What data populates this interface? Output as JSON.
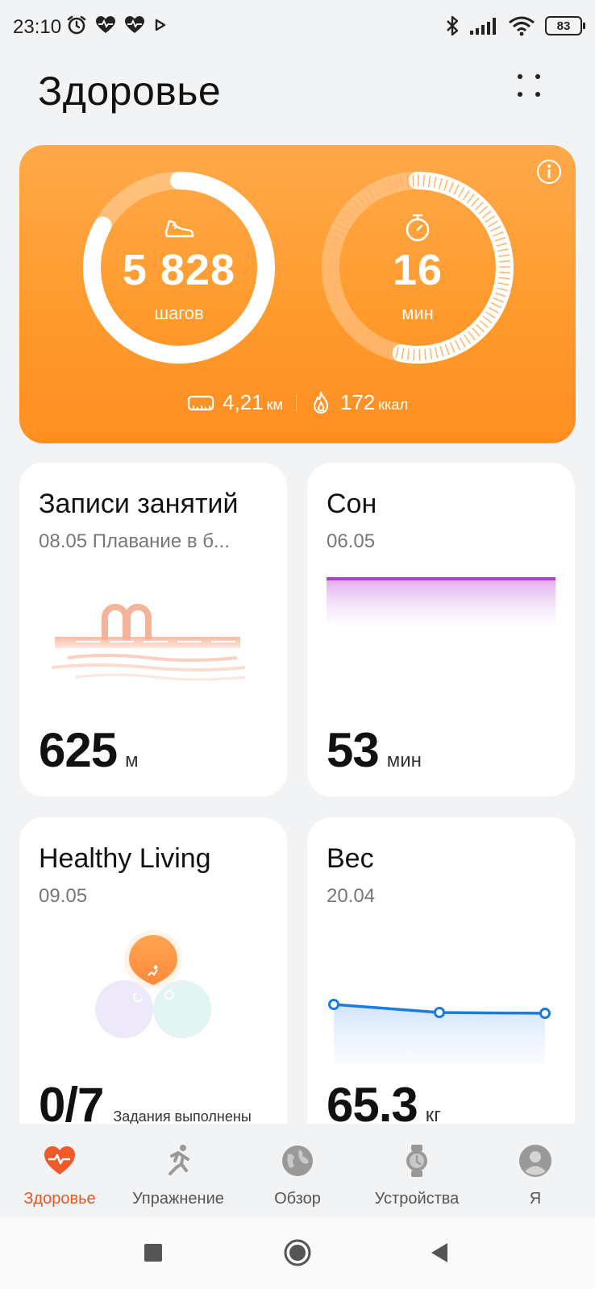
{
  "status_bar": {
    "time": "23:10",
    "battery": "83",
    "left_icons": [
      "alarm-icon",
      "heart-monitor-icon",
      "heart-monitor-icon",
      "play-icon"
    ],
    "right_icons": [
      "bluetooth-icon",
      "signal-icon",
      "wifi-icon",
      "battery-icon"
    ]
  },
  "header": {
    "title": "Здоровье"
  },
  "activity": {
    "steps_value": "5 828",
    "steps_unit": "шагов",
    "steps_progress": 0.83,
    "minutes_value": "16",
    "minutes_unit": "мин",
    "minutes_progress": 0.53,
    "distance_value": "4,21",
    "distance_unit": "км",
    "calories_value": "172",
    "calories_unit": "ккал",
    "accent": "#ff9b2e"
  },
  "tiles": {
    "workouts": {
      "title": "Записи занятий",
      "subtitle": "08.05 Плавание в б...",
      "value": "625",
      "unit": "м"
    },
    "sleep": {
      "title": "Сон",
      "subtitle": "06.05",
      "value": "53",
      "unit": "мин"
    },
    "healthy": {
      "title": "Healthy Living",
      "subtitle": "09.05",
      "value": "0/7",
      "unit": "Задания выполнены"
    },
    "weight": {
      "title": "Вес",
      "subtitle": "20.04",
      "value": "65.3",
      "unit": "кг"
    }
  },
  "nav": {
    "items": [
      {
        "label": "Здоровье",
        "icon": "heart-icon",
        "active": true
      },
      {
        "label": "Упражнение",
        "icon": "running-icon",
        "active": false
      },
      {
        "label": "Обзор",
        "icon": "globe-icon",
        "active": false
      },
      {
        "label": "Устройства",
        "icon": "watch-icon",
        "active": false
      },
      {
        "label": "Я",
        "icon": "profile-icon",
        "active": false
      }
    ],
    "active_color": "#e8571f"
  }
}
